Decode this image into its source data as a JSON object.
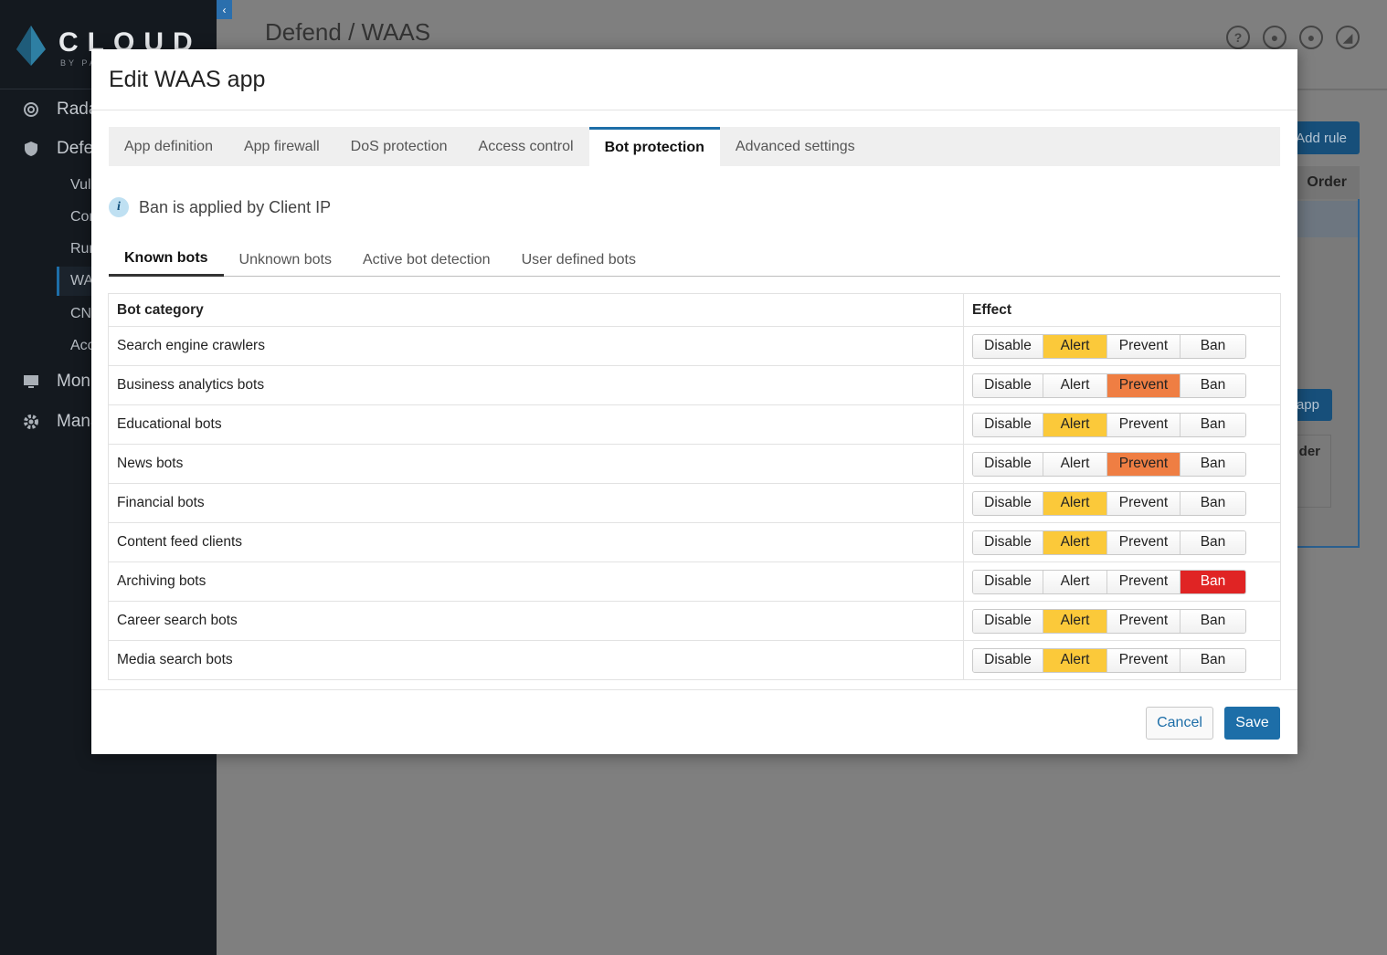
{
  "app": {
    "logo_text": "CLOUD",
    "logo_sub": "BY PA",
    "page_title": "Defend / WAAS"
  },
  "sidebar": {
    "items": [
      {
        "label": "Rada",
        "icon": "radar-icon"
      },
      {
        "label": "Defe",
        "icon": "shield-icon"
      },
      {
        "label": "Moni",
        "icon": "monitor-icon"
      },
      {
        "label": "Mana",
        "icon": "gear-icon"
      }
    ],
    "sub_items": [
      "Vul",
      "Cor",
      "Rur",
      "WA",
      "CN",
      "Acc"
    ]
  },
  "header_icons": [
    "help-icon",
    "bell-icon",
    "user-icon",
    "chart-icon"
  ],
  "background": {
    "add_rule_label": "Add rule",
    "order_header": "Order",
    "app_button_label": "app",
    "der_header": "der"
  },
  "modal": {
    "title": "Edit WAAS app",
    "tabs": [
      "App definition",
      "App firewall",
      "DoS protection",
      "Access control",
      "Bot protection",
      "Advanced settings"
    ],
    "active_tab": "Bot protection",
    "info_text": "Ban is applied by Client IP",
    "subtabs": [
      "Known bots",
      "Unknown bots",
      "Active bot detection",
      "User defined bots"
    ],
    "active_subtab": "Known bots",
    "table": {
      "headers": [
        "Bot category",
        "Effect"
      ],
      "effect_options": [
        "Disable",
        "Alert",
        "Prevent",
        "Ban"
      ],
      "rows": [
        {
          "category": "Search engine crawlers",
          "effect": "Alert"
        },
        {
          "category": "Business analytics bots",
          "effect": "Prevent"
        },
        {
          "category": "Educational bots",
          "effect": "Alert"
        },
        {
          "category": "News bots",
          "effect": "Prevent"
        },
        {
          "category": "Financial bots",
          "effect": "Alert"
        },
        {
          "category": "Content feed clients",
          "effect": "Alert"
        },
        {
          "category": "Archiving bots",
          "effect": "Ban"
        },
        {
          "category": "Career search bots",
          "effect": "Alert"
        },
        {
          "category": "Media search bots",
          "effect": "Alert"
        }
      ]
    },
    "cancel_label": "Cancel",
    "save_label": "Save"
  },
  "colors": {
    "accent": "#1d6ea8",
    "alert": "#fbc93a",
    "prevent": "#ef7e43",
    "ban": "#e02424",
    "sidebar_bg": "#14191f"
  }
}
